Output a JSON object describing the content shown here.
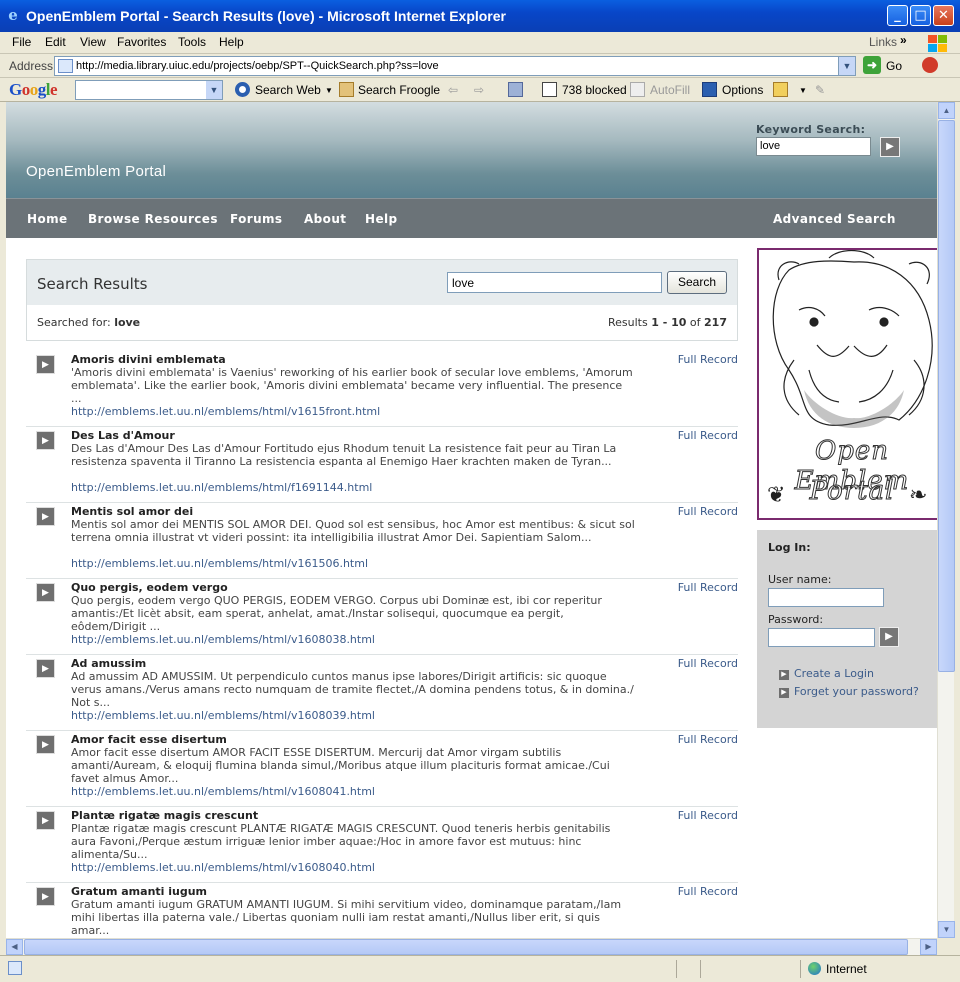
{
  "window": {
    "title": "OpenEmblem Portal - Search Results (love) - Microsoft Internet Explorer",
    "minimize": "_",
    "maximize": "□",
    "close": "✕"
  },
  "menu": {
    "items": [
      "File",
      "Edit",
      "View",
      "Favorites",
      "Tools",
      "Help"
    ],
    "links": "Links",
    "links_chevron": "»"
  },
  "address": {
    "label": "Address",
    "url": "http://media.library.uiuc.edu/projects/oebp/SPT--QuickSearch.php?ss=love",
    "go": "Go"
  },
  "google_toolbar": {
    "logo": "Google",
    "search_web": "Search Web",
    "search_froogle": "Search Froogle",
    "popups_blocked": "738 blocked",
    "autofill": "AutoFill",
    "options": "Options"
  },
  "page": {
    "portal_title": "OpenEmblem Portal",
    "keyword_label": "Keyword Search:",
    "keyword_value": "love",
    "nav": [
      "Home",
      "Browse Resources",
      "Forums",
      "About",
      "Help"
    ],
    "advanced_search": "Advanced Search",
    "results_heading": "Search Results",
    "search_value": "love",
    "search_button": "Search",
    "searched_for_label": "Searched for:",
    "searched_for_term": "love",
    "results_prefix": "Results",
    "results_range": "1 - 10",
    "results_of": "of",
    "results_total": "217",
    "full_record_label": "Full Record",
    "results": [
      {
        "title": "Amoris divini emblemata",
        "desc": "'Amoris divini emblemata' is Vaenius' reworking of his earlier book of secular love emblems, 'Amorum emblemata'. Like the earlier book, 'Amoris divini emblemata' became very influential. The presence ...",
        "url": "http://emblems.let.uu.nl/emblems/html/v1615front.html"
      },
      {
        "title": "Des Las d'Amour",
        "desc": "Des Las d'Amour Des Las d'Amour Fortitudo ejus Rhodum tenuit La resistence fait peur au Tiran La resistenza spaventa il Tiranno La resistencia espanta al Enemigo Haer krachten maken de Tyran...",
        "url": "http://emblems.let.uu.nl/emblems/html/f1691144.html"
      },
      {
        "title": "Mentis sol amor dei",
        "desc": "Mentis sol amor dei MENTIS SOL AMOR DEI. Quod sol est sensibus, hoc Amor est mentibus: & sicut sol terrena omnia illustrat vt videri possint: ita intelligibilia illustrat Amor Dei. Sapientiam Salom...",
        "url": "http://emblems.let.uu.nl/emblems/html/v161506.html"
      },
      {
        "title": "Quo pergis, eodem vergo",
        "desc": "Quo pergis, eodem vergo QUO PERGIS, EODEM VERGO. Corpus ubi Dominæ est, ibi cor reperitur amantis:/Et licèt absit, eam sperat, anhelat, amat./Instar solisequi, quocumque ea pergit, eôdem/Dirigit ...",
        "url": "http://emblems.let.uu.nl/emblems/html/v1608038.html"
      },
      {
        "title": "Ad amussim",
        "desc": "Ad amussim AD AMUSSIM. Ut perpendiculo cuntos manus ipse labores/Dirigit artificis: sic quoque verus amans./Verus amans recto numquam de tramite flectet,/A domina pendens totus, & in domina./ Not s...",
        "url": "http://emblems.let.uu.nl/emblems/html/v1608039.html"
      },
      {
        "title": "Amor facit esse disertum",
        "desc": "Amor facit esse disertum AMOR FACIT ESSE DISERTUM. Mercurij dat Amor virgam subtilis amanti/Auream, & eloquij flumina blanda simul,/Moribus atque illum placituris format amicae./Cui favet almus Amor...",
        "url": "http://emblems.let.uu.nl/emblems/html/v1608041.html"
      },
      {
        "title": "Plantæ rigatæ magis crescunt",
        "desc": "Plantæ rigatæ magis crescunt PLANTÆ RIGATÆ MAGIS CRESCUNT. Quod teneris herbis genitabilis aura Favoni,/Perque æstum irriguæ lenior imber aquae:/Hoc in amore favor est mutuus: hinc alimenta/Su...",
        "url": "http://emblems.let.uu.nl/emblems/html/v1608040.html"
      },
      {
        "title": "Gratum amanti iugum",
        "desc": "Gratum amanti iugum GRATUM AMANTI IUGUM. Si mihi servitium video, dominamque paratam,/Iam mihi libertas illa paterna vale./ Libertas quoniam nulli iam restat amanti,/Nullus liber erit, si quis amar...",
        "url": ""
      }
    ],
    "logo_line1": "Open Emblem",
    "logo_line2": "Portal",
    "login": {
      "heading": "Log In:",
      "username_label": "User name:",
      "password_label": "Password:",
      "create": "Create a Login",
      "forgot": "Forget your password?"
    }
  },
  "status": {
    "zone": "Internet"
  },
  "colors": {
    "nav_bg": "#6b7378",
    "link": "#3b5b8a",
    "logo_border": "#7a2a6e"
  }
}
